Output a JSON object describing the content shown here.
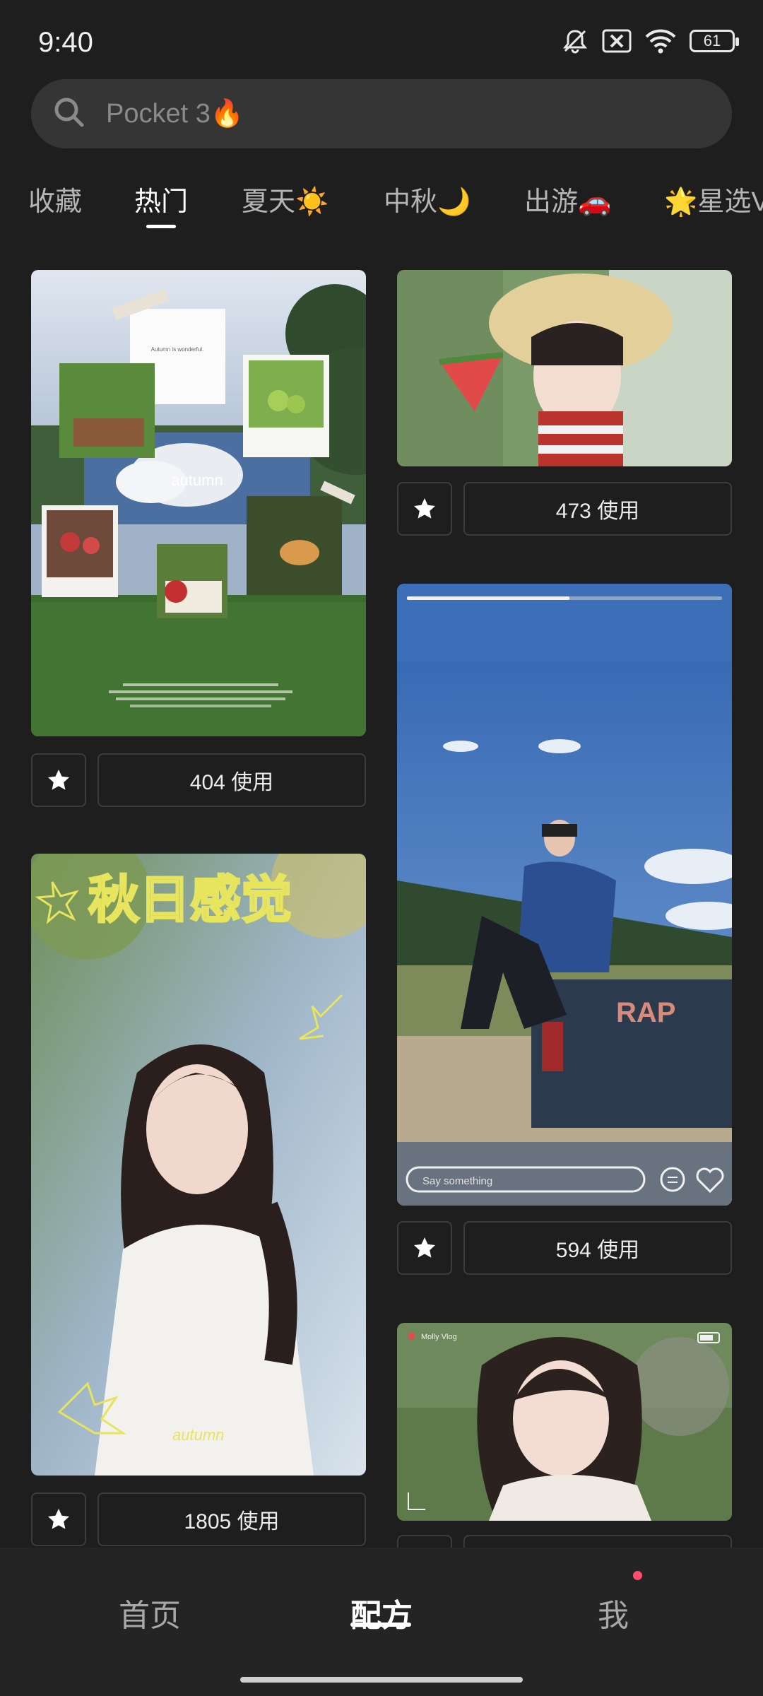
{
  "status": {
    "time": "9:40",
    "battery": "61"
  },
  "search": {
    "placeholder": "Pocket 3🔥"
  },
  "tabs": [
    {
      "label": "收藏"
    },
    {
      "label": "热门"
    },
    {
      "label": "夏天☀️"
    },
    {
      "label": "中秋🌙"
    },
    {
      "label": "出游🚗"
    },
    {
      "label": "🌟星选V"
    }
  ],
  "cards": [
    {
      "uses": "404 使用",
      "caption": "autumn",
      "note": "Autumn is wonderful."
    },
    {
      "uses": "473 使用"
    },
    {
      "uses": "594 使用",
      "input_placeholder": "Say something"
    },
    {
      "uses": "1805 使用",
      "title_art": "秋日感觉",
      "script": "autumn"
    },
    {
      "uses": "",
      "badge": "Molly Vlog"
    }
  ],
  "nav": [
    {
      "label": "首页"
    },
    {
      "label": "配方"
    },
    {
      "label": "我"
    }
  ],
  "colors": {
    "background": "#1e1e1e",
    "surface": "#353535",
    "accent_dot": "#ff4d6a"
  }
}
